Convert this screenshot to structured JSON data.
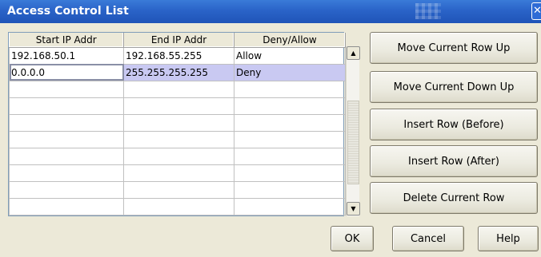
{
  "window": {
    "title": "Access Control List",
    "close_glyph": "✕"
  },
  "table": {
    "headers": [
      "Start IP Addr",
      "End IP Addr",
      "Deny/Allow"
    ],
    "rows": [
      [
        "192.168.50.1",
        "192.168.55.255",
        "Allow"
      ],
      [
        "0.0.0.0",
        "255.255.255.255",
        "Deny"
      ],
      [
        "",
        "",
        ""
      ],
      [
        "",
        "",
        ""
      ],
      [
        "",
        "",
        ""
      ],
      [
        "",
        "",
        ""
      ],
      [
        "",
        "",
        ""
      ],
      [
        "",
        "",
        ""
      ],
      [
        "",
        "",
        ""
      ],
      [
        "",
        "",
        ""
      ]
    ],
    "selected_row": 1
  },
  "scrollbar": {
    "up_glyph": "▲",
    "down_glyph": "▼"
  },
  "side_buttons": {
    "move_up": "Move Current Row Up",
    "move_down": "Move Current Down Up",
    "insert_before": "Insert Row (Before)",
    "insert_after": "Insert Row (After)",
    "delete": "Delete Current Row"
  },
  "dialog_buttons": {
    "ok": "OK",
    "cancel": "Cancel",
    "help": "Help"
  },
  "colors": {
    "title_bar": "#2a63c8",
    "dialog_bg": "#ece9d8",
    "selected_row": "#c9c9f2"
  }
}
